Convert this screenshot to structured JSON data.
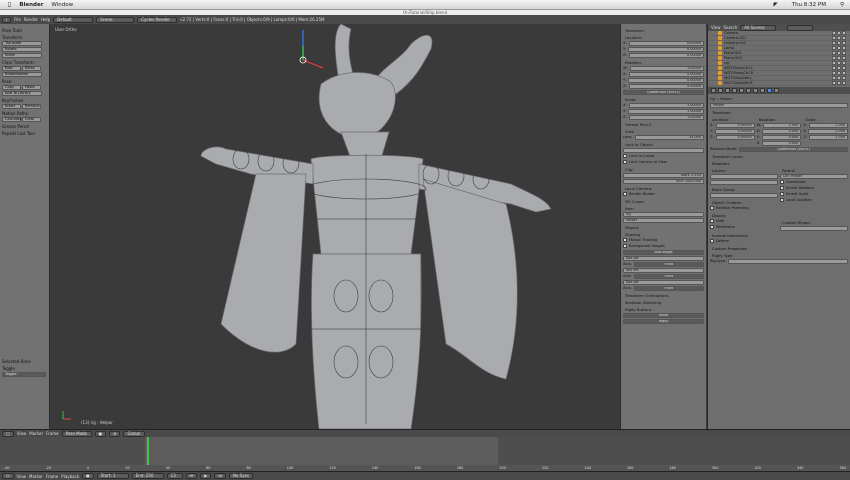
{
  "macbar": {
    "app_name": "Blender",
    "menu": "Window",
    "clock": "Thu 8:32 PM"
  },
  "window_title": "OniTutorial/Ship.blend",
  "topbar": {
    "menus": [
      "File",
      "Render",
      "Help"
    ],
    "layout": "Default",
    "scene": "Scene",
    "engine": "Cycles Render",
    "stats": "v2.72 | Verts:0 | Faces:0 | Tris:0 | Objects:0/9 | Lamps:0/0 | Mem:26.25M"
  },
  "tools": {
    "header": "Pose Tools",
    "transform_label": "Transform:",
    "transform": [
      "Translate",
      "Rotate",
      "Scale"
    ],
    "clear_label": "Clear Transform:",
    "clear_pair": [
      "Rest",
      "Relax"
    ],
    "breakdowner": "Breakdowner",
    "pose_label": "Pose:",
    "pose_pair": [
      "Copy",
      "Paste"
    ],
    "add_library": "Add To Library",
    "keyframes_label": "Keyframes:",
    "key_pair": [
      "Insert",
      "Remove"
    ],
    "motion_label": "Motion Paths:",
    "motion_pair": [
      "Calculate",
      "Clear"
    ],
    "grease": "Grease Pencil",
    "repeat": "Repeat Last Tool",
    "bottom_section": "Selected Bone",
    "toggle_label": "Toggle",
    "bottom_value": "Toggle"
  },
  "viewport": {
    "label": "User Ortho",
    "object": "(13) rig : Helper",
    "colors": {
      "bg": "#3a3a3a",
      "mesh": "#a7a9ad"
    }
  },
  "props": {
    "transform_header": "Transform",
    "location_label": "Location:",
    "location": [
      "X:",
      "0.00000",
      "Y:",
      "0.00000",
      "Z:",
      "0.00000"
    ],
    "rotation_label": "Rotation:",
    "rotation": [
      "W:",
      "1.00000",
      "X:",
      "0.00000",
      "Y:",
      "0.00000",
      "Z:",
      "0.00000"
    ],
    "rot_mode": "Quaternion (WXYZ)",
    "scale_label": "Scale:",
    "scale": [
      "X:",
      "1.00000",
      "Y:",
      "1.00000",
      "Z:",
      "1.00000"
    ],
    "grease_header": "Grease Pencil",
    "view_header": "View",
    "lens_label": "Lens:",
    "lens_value": "35.000",
    "lock_label": "Lock to Object:",
    "lock_cursor": "Lock to Cursor",
    "lock_camera": "Lock Camera to View",
    "clip_label": "Clip:",
    "clip_start": "Start:  0.100",
    "clip_end": "End:  1000.000",
    "local_camera": "Local Camera:",
    "render_border": "Render Border",
    "cursor_header": "3D Cursor",
    "item_header": "Item",
    "item_name": "rig",
    "item_sub": "Helper",
    "display_header": "Display",
    "shading_header": "Shading",
    "motion_tracking": "Motion Tracking",
    "bg_images": "Background Images",
    "add_image": "Add Image",
    "image_entries": [
      "Not Set",
      "Not Set",
      "Not Set"
    ],
    "axis_label": "Axis:",
    "axis_value": "Front",
    "transform_orient": "Transform Orientations",
    "skeleton_sketch": "Skeleton Sketching",
    "rigify_header": "Rigify Buttons",
    "rigify_btn1": "Reset",
    "rigify_btn2": "Rigify"
  },
  "outliner": {
    "view_label": "View",
    "search_label": "Search",
    "scene_select": "All Scenes",
    "items": [
      "Camera",
      "Camera.001",
      "Camera.002",
      "Lamp",
      "Plane.001",
      "Plane.002",
      "rig",
      "WGT-ProxyCtrl.L",
      "WGT-ProxyCtrl.R",
      "WGT-Shoulder.L",
      "WGT-Shoulder.R"
    ]
  },
  "bone_props": {
    "breadcrumb": [
      "rig",
      "Helper"
    ],
    "name_value": "Helper",
    "transform_header": "Transform",
    "loc_label": "Location:",
    "rot_label": "Rotation:",
    "scale_label": "Scale:",
    "loc": [
      "X:",
      "0.00000",
      "Y:",
      "0.00000",
      "Z:",
      "0.00000"
    ],
    "rot": [
      "W:",
      "1.000",
      "X:",
      "0.000",
      "Y:",
      "0.000",
      "Z:",
      "0.000"
    ],
    "scl": [
      "X:",
      "1.000",
      "Y:",
      "1.000",
      "Z:",
      "1.000"
    ],
    "rotation_mode_label": "Rotation Mode:",
    "rotation_mode": "Quaternion (WXYZ)",
    "locks_header": "Transform Locks",
    "relations_header": "Relations",
    "layers_label": "Layers:",
    "parent_label": "Parent:",
    "parent_value": "DEF-Helper",
    "connected": "Connected",
    "inherit_rotation": "Inherit Rotation",
    "inherit_scale": "Inherit Scale",
    "local_location": "Local Location",
    "bone_group_label": "Bone Group:",
    "object_children": "Object Children:",
    "relative_parenting": "Relative Parenting",
    "display_header": "Display",
    "hide": "Hide",
    "custom_shape": "Custom Shape:",
    "wireframe": "Wireframe",
    "inverse_kinematics": "Inverse Kinematics",
    "deform": "Deform",
    "custom_properties": "Custom Properties",
    "rigify_type": "Rigify Type",
    "rig_type_label": "Rig type:"
  },
  "timeline": {
    "menus": [
      "View",
      "Marker",
      "Frame",
      "Playback"
    ],
    "mode": "Pose Mode",
    "orientation": "Global",
    "ruler": [
      "-40",
      "-20",
      "0",
      "20",
      "40",
      "60",
      "80",
      "100",
      "120",
      "140",
      "160",
      "180",
      "200",
      "220",
      "240",
      "260",
      "280",
      "300",
      "320",
      "340",
      "360"
    ],
    "start": "Start: 1",
    "end": "End: 250",
    "current": "13",
    "sync": "No Sync"
  }
}
